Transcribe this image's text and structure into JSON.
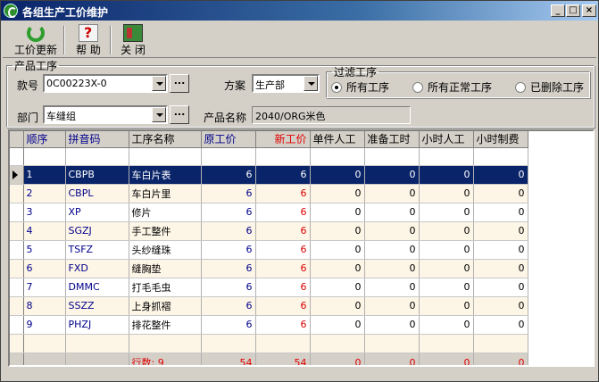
{
  "window": {
    "title": "各组生产工价维护",
    "minimize": "_",
    "maximize": "□",
    "close": "×"
  },
  "toolbar": {
    "update_label": "工价更新",
    "help_label": "帮 助",
    "close_label": "关 闭"
  },
  "product_group": {
    "legend": "产品工序",
    "style_label": "款号",
    "style_value": "0C00223X-0",
    "scheme_label": "方案",
    "scheme_value": "生产部",
    "dept_label": "部门",
    "dept_value": "车缝组",
    "product_name_label": "产品名称",
    "product_name_value": "2040/ORG米色",
    "dots": "..."
  },
  "filter_group": {
    "legend": "过滤工序",
    "options": [
      "所有工序",
      "所有正常工序",
      "已删除工序"
    ],
    "selected": 0
  },
  "grid": {
    "columns": [
      "顺序",
      "拼音码",
      "工序名称",
      "原工价",
      "新工价",
      "单件人工",
      "准备工时",
      "小时人工",
      "小时制费"
    ],
    "rows": [
      [
        "1",
        "CBPB",
        "车白片表",
        "6",
        "6",
        "0",
        "0",
        "0",
        "0"
      ],
      [
        "2",
        "CBPL",
        "车白片里",
        "6",
        "6",
        "0",
        "0",
        "0",
        "0"
      ],
      [
        "3",
        "XP",
        "修片",
        "6",
        "6",
        "0",
        "0",
        "0",
        "0"
      ],
      [
        "4",
        "SGZJ",
        "手工整件",
        "6",
        "6",
        "0",
        "0",
        "0",
        "0"
      ],
      [
        "5",
        "TSFZ",
        "头纱缝珠",
        "6",
        "6",
        "0",
        "0",
        "0",
        "0"
      ],
      [
        "6",
        "FXD",
        "缝胸垫",
        "6",
        "6",
        "0",
        "0",
        "0",
        "0"
      ],
      [
        "7",
        "DMMC",
        "打毛毛虫",
        "6",
        "6",
        "0",
        "0",
        "0",
        "0"
      ],
      [
        "8",
        "SSZZ",
        "上身抓褶",
        "6",
        "6",
        "0",
        "0",
        "0",
        "0"
      ],
      [
        "9",
        "PHZJ",
        "排花整件",
        "6",
        "6",
        "0",
        "0",
        "0",
        "0"
      ]
    ],
    "selected_row": 0,
    "footer": {
      "count_text": "行数: 9",
      "orig_total": "54",
      "new_total": "54",
      "unit_labor": "0",
      "prep_time": "0",
      "hour_labor": "0",
      "hour_cost": "0"
    }
  },
  "colors": {
    "title_bar": "#0a246a",
    "selection": "#0a246a",
    "row_alt": "#fdf5e6",
    "accent_blue": "#00008b",
    "accent_red": "#e00000"
  }
}
